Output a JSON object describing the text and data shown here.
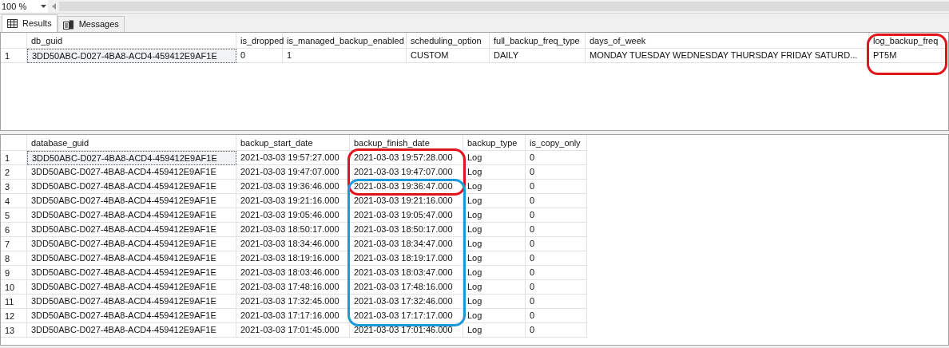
{
  "zoom": {
    "value": "100 %"
  },
  "tabs": [
    {
      "label": "Results",
      "selected": true,
      "kind": "grid"
    },
    {
      "label": "Messages",
      "selected": false,
      "kind": "messages"
    }
  ],
  "grids": [
    {
      "columns": [
        "db_guid",
        "is_dropped",
        "is_managed_backup_enabled",
        "scheduling_option",
        "full_backup_freq_type",
        "days_of_week",
        "log_backup_freq"
      ],
      "rows": [
        {
          "number": "1",
          "cells": [
            "3DD50ABC-D027-4BA8-ACD4-459412E9AF1E",
            "0",
            "1",
            "CUSTOM",
            "DAILY",
            "MONDAY TUESDAY WEDNESDAY THURSDAY FRIDAY SATURD...",
            "PT5M"
          ]
        }
      ]
    },
    {
      "columns": [
        "database_guid",
        "backup_start_date",
        "backup_finish_date",
        "backup_type",
        "is_copy_only"
      ],
      "rows": [
        {
          "number": "1",
          "cells": [
            "3DD50ABC-D027-4BA8-ACD4-459412E9AF1E",
            "2021-03-03 19:57:27.000",
            "2021-03-03 19:57:28.000",
            "Log",
            "0"
          ]
        },
        {
          "number": "2",
          "cells": [
            "3DD50ABC-D027-4BA8-ACD4-459412E9AF1E",
            "2021-03-03 19:47:07.000",
            "2021-03-03 19:47:07.000",
            "Log",
            "0"
          ]
        },
        {
          "number": "3",
          "cells": [
            "3DD50ABC-D027-4BA8-ACD4-459412E9AF1E",
            "2021-03-03 19:36:46.000",
            "2021-03-03 19:36:47.000",
            "Log",
            "0"
          ]
        },
        {
          "number": "4",
          "cells": [
            "3DD50ABC-D027-4BA8-ACD4-459412E9AF1E",
            "2021-03-03 19:21:16.000",
            "2021-03-03 19:21:16.000",
            "Log",
            "0"
          ]
        },
        {
          "number": "5",
          "cells": [
            "3DD50ABC-D027-4BA8-ACD4-459412E9AF1E",
            "2021-03-03 19:05:46.000",
            "2021-03-03 19:05:47.000",
            "Log",
            "0"
          ]
        },
        {
          "number": "6",
          "cells": [
            "3DD50ABC-D027-4BA8-ACD4-459412E9AF1E",
            "2021-03-03 18:50:17.000",
            "2021-03-03 18:50:17.000",
            "Log",
            "0"
          ]
        },
        {
          "number": "7",
          "cells": [
            "3DD50ABC-D027-4BA8-ACD4-459412E9AF1E",
            "2021-03-03 18:34:46.000",
            "2021-03-03 18:34:47.000",
            "Log",
            "0"
          ]
        },
        {
          "number": "8",
          "cells": [
            "3DD50ABC-D027-4BA8-ACD4-459412E9AF1E",
            "2021-03-03 18:19:16.000",
            "2021-03-03 18:19:17.000",
            "Log",
            "0"
          ]
        },
        {
          "number": "9",
          "cells": [
            "3DD50ABC-D027-4BA8-ACD4-459412E9AF1E",
            "2021-03-03 18:03:46.000",
            "2021-03-03 18:03:47.000",
            "Log",
            "0"
          ]
        },
        {
          "number": "10",
          "cells": [
            "3DD50ABC-D027-4BA8-ACD4-459412E9AF1E",
            "2021-03-03 17:48:16.000",
            "2021-03-03 17:48:16.000",
            "Log",
            "0"
          ]
        },
        {
          "number": "11",
          "cells": [
            "3DD50ABC-D027-4BA8-ACD4-459412E9AF1E",
            "2021-03-03 17:32:45.000",
            "2021-03-03 17:32:46.000",
            "Log",
            "0"
          ]
        },
        {
          "number": "12",
          "cells": [
            "3DD50ABC-D027-4BA8-ACD4-459412E9AF1E",
            "2021-03-03 17:17:16.000",
            "2021-03-03 17:17:17.000",
            "Log",
            "0"
          ]
        },
        {
          "number": "13",
          "cells": [
            "3DD50ABC-D027-4BA8-ACD4-459412E9AF1E",
            "2021-03-03 17:01:45.000",
            "2021-03-03 17:01:46.000",
            "Log",
            "0"
          ]
        }
      ]
    }
  ],
  "annotations": [
    {
      "kind": "oval",
      "color": "#e3131b"
    },
    {
      "kind": "oval",
      "color": "#e3131b"
    },
    {
      "kind": "oval",
      "color": "#1a9ad8"
    }
  ]
}
